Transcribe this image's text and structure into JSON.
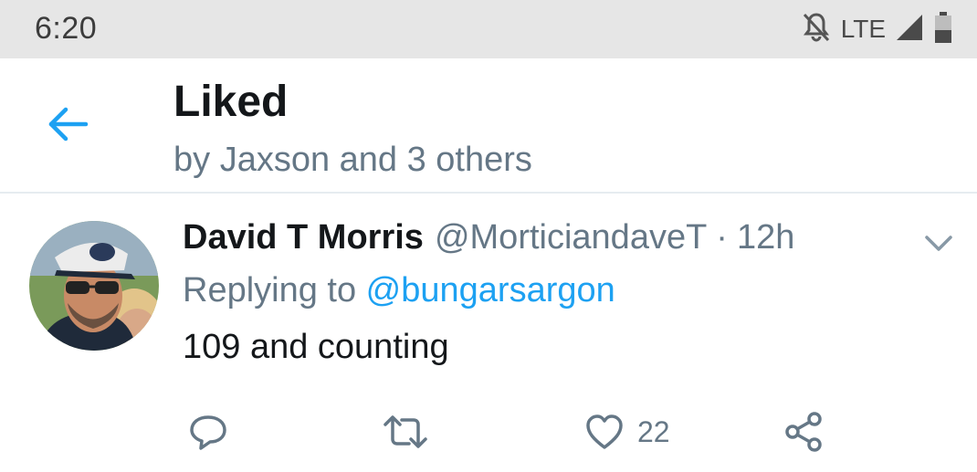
{
  "status_bar": {
    "time": "6:20",
    "network": "LTE",
    "icons": [
      "notifications-off-icon",
      "signal-icon",
      "battery-icon"
    ]
  },
  "header": {
    "title": "Liked",
    "subtitle": "by Jaxson and 3 others",
    "back_icon": "arrow-left-icon"
  },
  "tweet": {
    "author_name": "David T Morris",
    "author_handle": "@MorticiandaveT",
    "separator": "·",
    "time": "12h",
    "replying_prefix": "Replying to ",
    "replying_to": "@bungarsargon",
    "text": "109 and counting",
    "actions": {
      "reply_icon": "reply-icon",
      "retweet_icon": "retweet-icon",
      "like_icon": "heart-icon",
      "like_count": "22",
      "share_icon": "share-icon"
    }
  },
  "colors": {
    "accent": "#1da1f2",
    "text_primary": "#14171a",
    "text_secondary": "#657786",
    "status_bar_bg": "#e6e6e6"
  }
}
